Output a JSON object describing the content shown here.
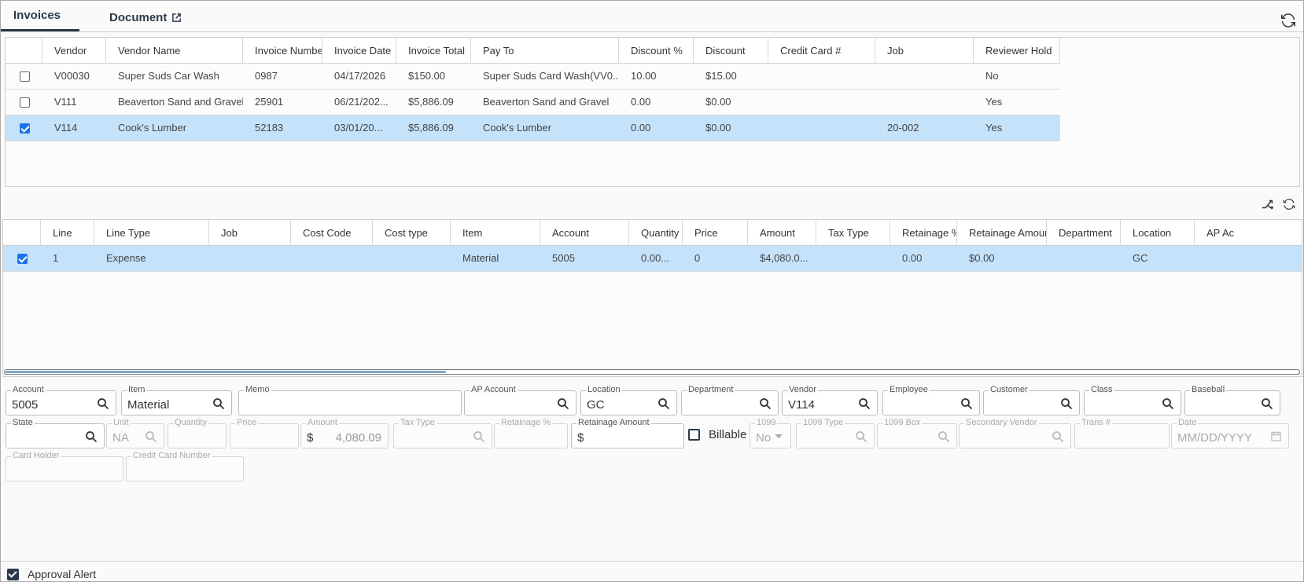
{
  "tabs": {
    "invoices": "Invoices",
    "document": "Document"
  },
  "invoice_grid": {
    "columns": [
      "Vendor",
      "Vendor Name",
      "Invoice Number",
      "Invoice Date",
      "Invoice Total",
      "Pay To",
      "Discount %",
      "Discount",
      "Credit Card #",
      "Job",
      "Reviewer Hold"
    ],
    "rows": [
      {
        "checked": false,
        "cells": [
          "V00030",
          "Super Suds Car Wash",
          "0987",
          "04/17/2026",
          "$150.00",
          "Super Suds Card Wash(VV0...",
          "10.00",
          "$15.00",
          "",
          "",
          "No"
        ]
      },
      {
        "checked": false,
        "cells": [
          "V111",
          "Beaverton Sand and Gravel",
          "25901",
          "06/21/202...",
          "$5,886.09",
          "Beaverton Sand and Gravel",
          "0.00",
          "$0.00",
          "",
          "",
          "Yes"
        ]
      },
      {
        "checked": true,
        "cells": [
          "V114",
          "Cook's Lumber",
          "52183",
          "03/01/20...",
          "$5,886.09",
          "Cook's Lumber",
          "0.00",
          "$0.00",
          "",
          "20-002",
          "Yes"
        ]
      }
    ]
  },
  "line_grid": {
    "columns": [
      "Line",
      "Line Type",
      "Job",
      "Cost Code",
      "Cost type",
      "Item",
      "Account",
      "Quantity",
      "Price",
      "Amount",
      "Tax Type",
      "Retainage %",
      "Retainage Amount",
      "Department",
      "Location",
      "AP Ac"
    ],
    "rows": [
      {
        "checked": true,
        "cells": [
          "1",
          "Expense",
          "",
          "",
          "",
          "Material",
          "5005",
          "0.00...",
          "0",
          "$4,080.0...",
          "",
          "0.00",
          "$0.00",
          "",
          "GC",
          ""
        ]
      }
    ],
    "scroll_fraction": 0.34
  },
  "form": {
    "account": {
      "label": "Account",
      "value": "5005"
    },
    "item": {
      "label": "Item",
      "value": "Material"
    },
    "memo": {
      "label": "Memo",
      "value": ""
    },
    "ap_account": {
      "label": "AP Account",
      "value": ""
    },
    "location": {
      "label": "Location",
      "value": "GC"
    },
    "department": {
      "label": "Department",
      "value": ""
    },
    "vendor": {
      "label": "Vendor",
      "value": "V114"
    },
    "employee": {
      "label": "Employee",
      "value": ""
    },
    "customer": {
      "label": "Customer",
      "value": ""
    },
    "class": {
      "label": "Class",
      "value": ""
    },
    "baseball": {
      "label": "Baseball",
      "value": ""
    },
    "state": {
      "label": "State",
      "value": ""
    },
    "unit": {
      "label": "Unit",
      "value": "NA"
    },
    "quantity": {
      "label": "Quantity",
      "value": ""
    },
    "price": {
      "label": "Price",
      "value": ""
    },
    "amount": {
      "label": "Amount",
      "prefix": "$",
      "value": "4,080.09"
    },
    "tax_type": {
      "label": "Tax Type",
      "value": ""
    },
    "retainage_pct": {
      "label": "Retainage %",
      "value": ""
    },
    "retainage_amount": {
      "label": "Retainage Amount",
      "prefix": "$",
      "value": ""
    },
    "billable": {
      "label": "Billable",
      "checked": false
    },
    "f1099": {
      "label": "1099",
      "value": "No"
    },
    "f1099_type": {
      "label": "1099 Type",
      "value": ""
    },
    "f1099_box": {
      "label": "1099 Box",
      "value": ""
    },
    "secondary_vendor": {
      "label": "Secondary Vendor",
      "value": ""
    },
    "trans": {
      "label": "Trans #",
      "value": ""
    },
    "date": {
      "label": "Date",
      "placeholder": "MM/DD/YYYY"
    },
    "card_holder": {
      "label": "Card Holder",
      "value": ""
    },
    "credit_card_number": {
      "label": "Credit Card Number",
      "value": ""
    }
  },
  "approval_alert": {
    "label": "Approval Alert",
    "checked": true
  },
  "colors": {
    "selected_row": "#c5e2fb",
    "accent": "#2b3a4a",
    "checkbox_blue": "#1a73e8"
  }
}
